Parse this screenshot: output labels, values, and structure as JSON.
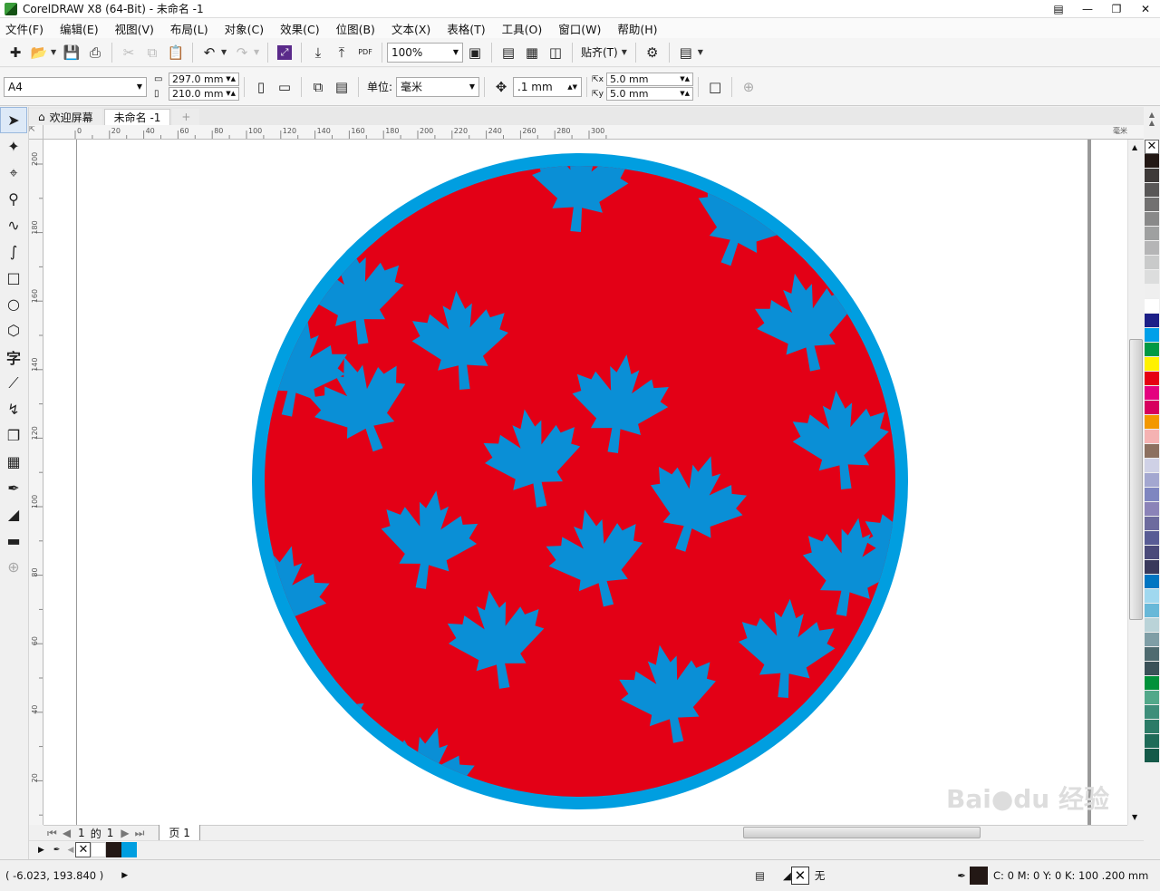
{
  "window": {
    "title": "CorelDRAW X8 (64-Bit) - 未命名 -1"
  },
  "menu": [
    "文件(F)",
    "编辑(E)",
    "视图(V)",
    "布局(L)",
    "对象(C)",
    "效果(C)",
    "位图(B)",
    "文本(X)",
    "表格(T)",
    "工具(O)",
    "窗口(W)",
    "帮助(H)"
  ],
  "toolbar": {
    "zoom": "100%",
    "snap_label": "贴齐(T)"
  },
  "propbar": {
    "page_size": "A4",
    "width": "297.0 mm",
    "height": "210.0 mm",
    "units_label": "单位:",
    "units": "毫米",
    "nudge": ".1 mm",
    "dup_x": "5.0 mm",
    "dup_y": "5.0 mm"
  },
  "doc_tabs": [
    "欢迎屏幕",
    "未命名 -1"
  ],
  "ruler_h": [
    "0",
    "20",
    "40",
    "60",
    "80",
    "100",
    "120",
    "140",
    "160",
    "180",
    "200",
    "220",
    "240",
    "260",
    "280",
    "300"
  ],
  "ruler_h_unit": "毫米",
  "ruler_v": [
    "200",
    "180",
    "160",
    "140",
    "120",
    "100",
    "80",
    "60",
    "40",
    "20"
  ],
  "page_nav": {
    "current": "1",
    "of_label": "的",
    "total": "1",
    "page_tab": "页 1"
  },
  "status": {
    "coords": "( -6.023, 193.840 )",
    "fill_label": "无",
    "color_info": "C: 0 M: 0 Y: 0 K: 100 .200 mm"
  },
  "artwork": {
    "ring_color": "#009ee0",
    "fill_color": "#e30016",
    "leaf_color": "#0a8fd6"
  },
  "palette_colors": [
    "#231815",
    "#3e3a39",
    "#595757",
    "#727171",
    "#898989",
    "#9fa0a0",
    "#b5b5b6",
    "#c9caca",
    "#dcdddd",
    "#efefef",
    "#ffffff",
    "#1d2088",
    "#00a0e9",
    "#009944",
    "#fff100",
    "#e60012",
    "#e4007f",
    "#d7005e",
    "#f39800",
    "#f5b2b2",
    "#8c7060",
    "#cfd1e6",
    "#a3a7d0",
    "#7f86c0",
    "#8b83b8",
    "#6d6b9e",
    "#585c95",
    "#4a4a7a",
    "#39395c",
    "#0075c2",
    "#a0d8ef",
    "#68b8d8",
    "#bad3d8",
    "#7f9ea6",
    "#4f6b70",
    "#3a5158",
    "#00913a",
    "#52a88a",
    "#3e8e7a",
    "#2c7b67",
    "#1f6b58",
    "#155a49"
  ]
}
